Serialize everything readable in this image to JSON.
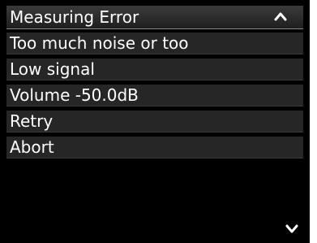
{
  "header": {
    "title": "Measuring Error",
    "scroll_up_icon": "chevron-up-icon"
  },
  "items": [
    {
      "label": "Too much noise or too"
    },
    {
      "label": "Low signal"
    },
    {
      "label": "Volume -50.0dB"
    },
    {
      "label": "Retry"
    },
    {
      "label": "Abort"
    }
  ],
  "scroll_down_icon": "chevron-down-icon",
  "colors": {
    "background": "#000000",
    "row_background": "#262626",
    "text": "#ffffff"
  }
}
